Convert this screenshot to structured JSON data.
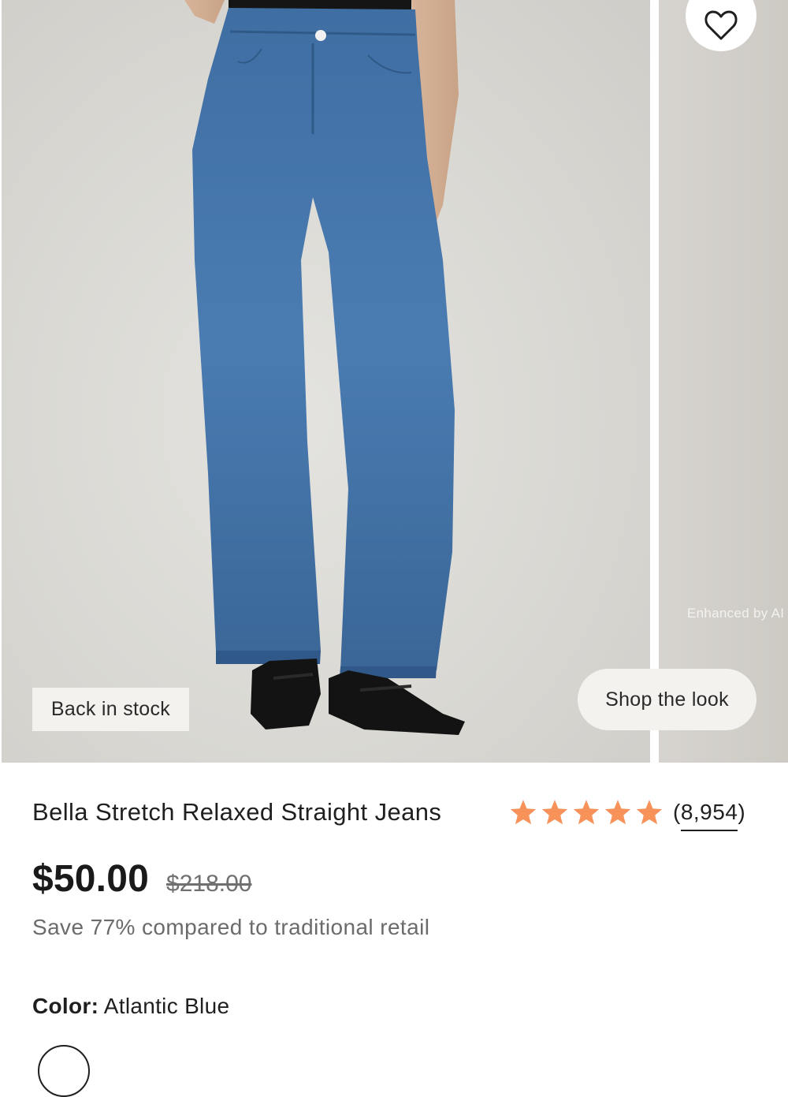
{
  "gallery": {
    "badge": "Back in stock",
    "enhanced_label": "Enhanced by AI",
    "shop_look_label": "Shop the look"
  },
  "product": {
    "title": "Bella Stretch Relaxed Straight Jeans",
    "rating_stars": 5,
    "review_count": "(8,954)",
    "price": "$50.00",
    "original_price": "$218.00",
    "savings": "Save 77% compared to traditional retail",
    "color_label": "Color:",
    "color_value": "Atlantic Blue"
  },
  "colors": {
    "star": "#f6925a",
    "accent_text": "#1f1f1f",
    "muted_text": "#6b6b6b"
  },
  "icons": {
    "favorite": "heart-icon",
    "rating": "star-icon"
  }
}
